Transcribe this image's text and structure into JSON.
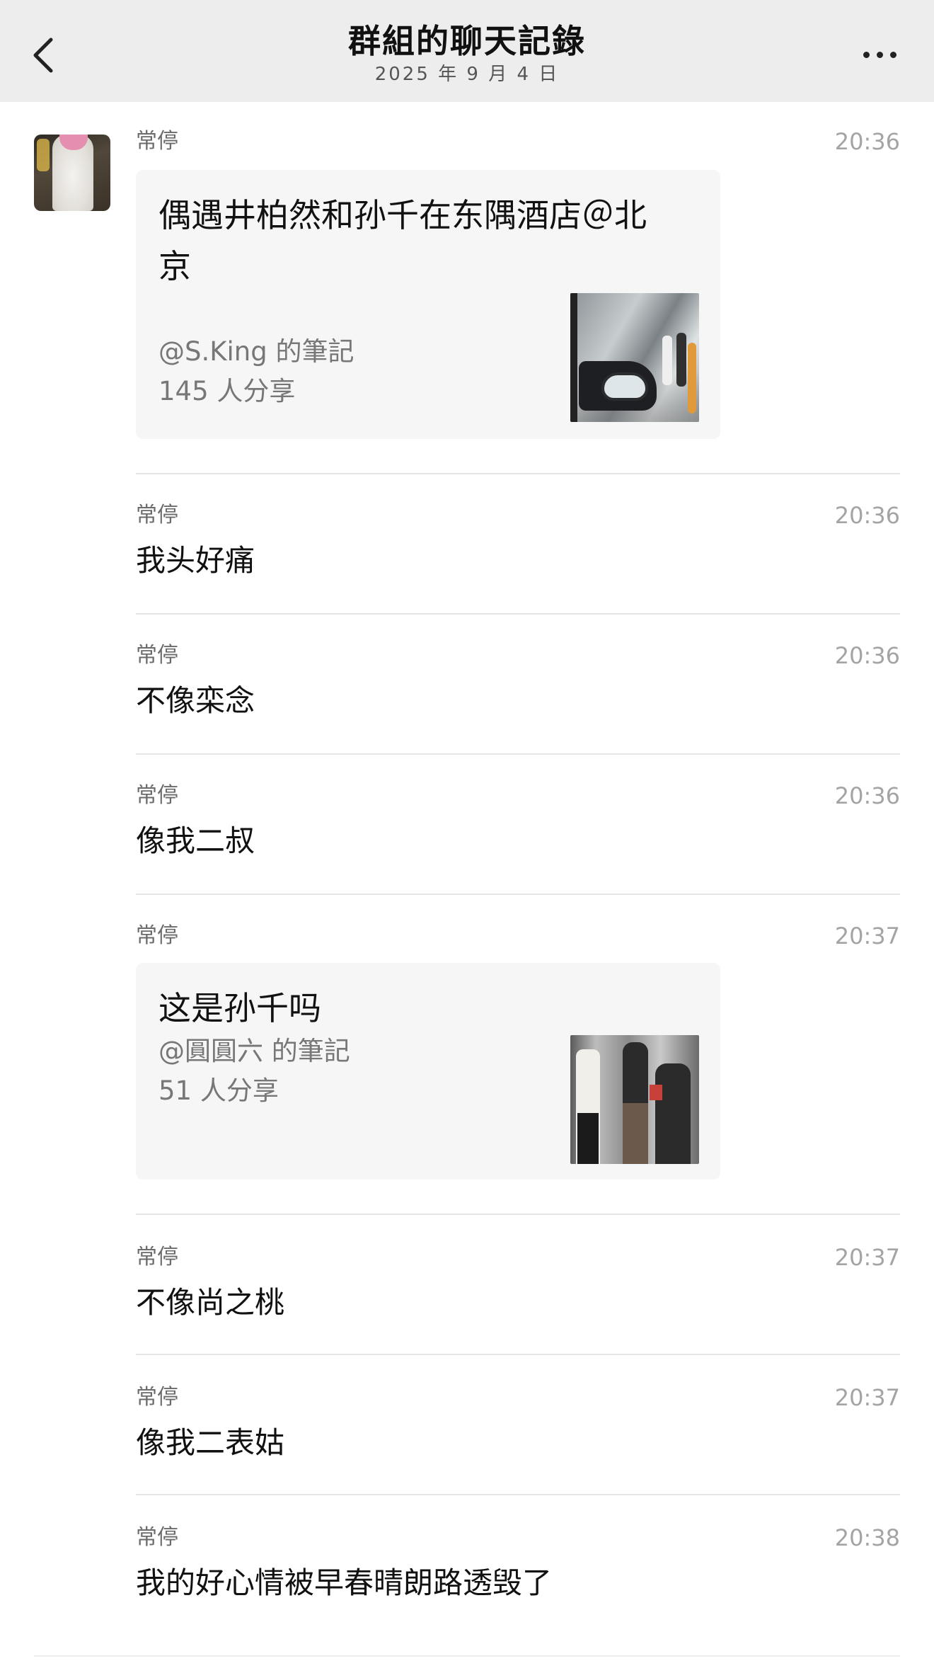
{
  "header": {
    "title": "群組的聊天記錄",
    "date": "2025 年 9 月 4 日"
  },
  "messages": [
    {
      "sender": "常停",
      "time": "20:36",
      "type": "note",
      "card": {
        "title": "偶遇井柏然和孙千在东隅酒店＠北京",
        "author": "@S.King 的筆記",
        "shares": "145 人分享"
      }
    },
    {
      "sender": "常停",
      "time": "20:36",
      "type": "text",
      "text": "我头好痛"
    },
    {
      "sender": "常停",
      "time": "20:36",
      "type": "text",
      "text": "不像栾念"
    },
    {
      "sender": "常停",
      "time": "20:36",
      "type": "text",
      "text": "像我二叔"
    },
    {
      "sender": "常停",
      "time": "20:37",
      "type": "note",
      "card": {
        "title": "这是孙千吗",
        "author": "@圓圓六 的筆記",
        "shares": "51 人分享"
      }
    },
    {
      "sender": "常停",
      "time": "20:37",
      "type": "text",
      "text": "不像尚之桃"
    },
    {
      "sender": "常停",
      "time": "20:37",
      "type": "text",
      "text": "像我二表姑"
    },
    {
      "sender": "常停",
      "time": "20:38",
      "type": "text",
      "text": "我的好心情被早春晴朗路透毁了"
    }
  ],
  "colors": {
    "header_bg": "#ededed",
    "card_bg": "#f6f6f6",
    "meta_text": "#6b6b6b",
    "time_text": "#a4a4a4"
  },
  "icons": [
    "chevron-left-icon",
    "more-icon"
  ]
}
